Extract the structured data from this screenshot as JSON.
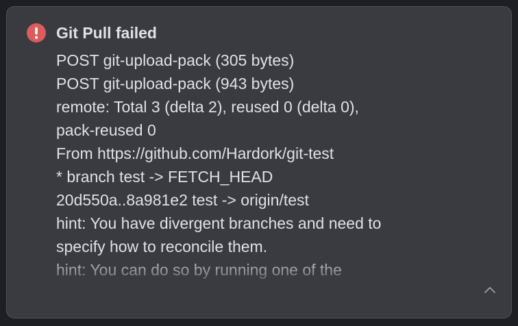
{
  "notification": {
    "title": "Git Pull failed",
    "lines": [
      "POST git-upload-pack (305 bytes)",
      "POST git-upload-pack (943 bytes)",
      "remote: Total 3 (delta 2), reused 0 (delta 0),",
      "pack-reused 0",
      "From https://github.com/Hardork/git-test",
      "* branch test -> FETCH_HEAD",
      "20d550a..8a981e2 test -> origin/test",
      "hint: You have divergent branches and need to",
      "specify how to reconcile them.",
      "hint: You can do so by running one of the"
    ],
    "status_icon": "error-icon",
    "collapse_icon": "chevron-up-icon"
  },
  "colors": {
    "background": "#1e1f22",
    "panel": "#393b40",
    "text": "#dfe1e5",
    "error": "#db5c5c"
  }
}
